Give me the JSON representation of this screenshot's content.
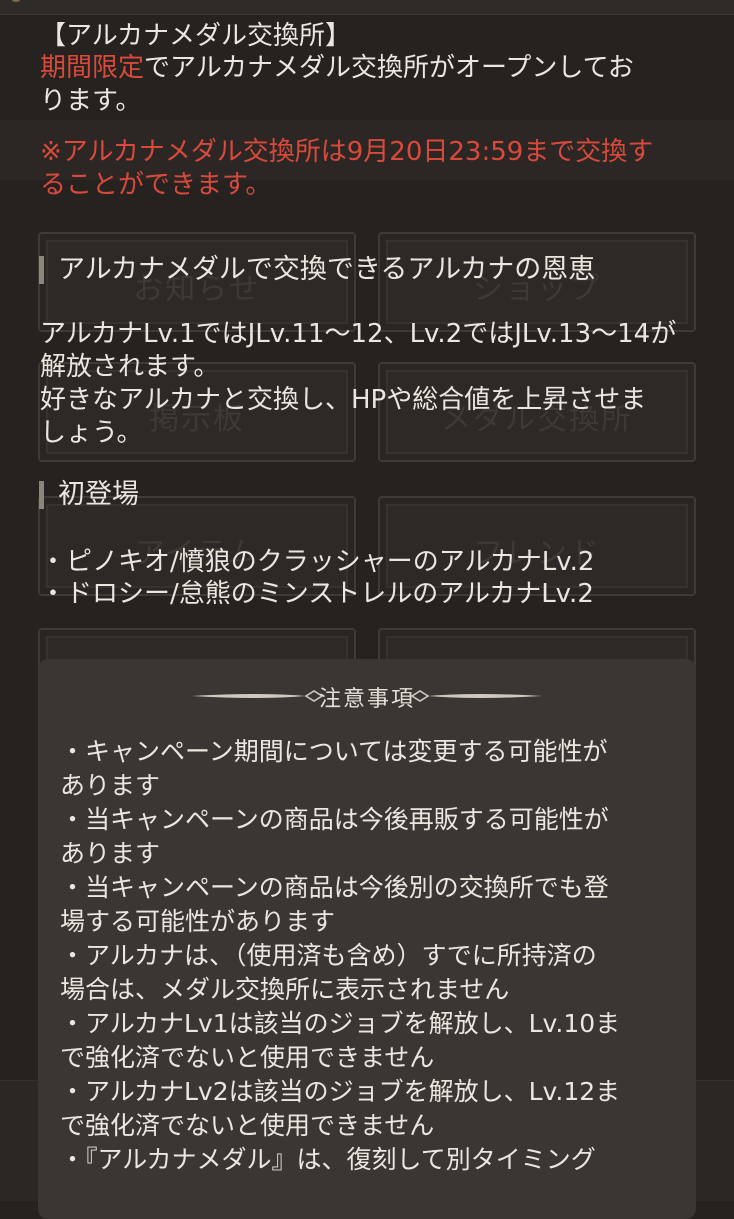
{
  "background": {
    "tiles": [
      {
        "label": "お知らせ"
      },
      {
        "label": "ショップ"
      },
      {
        "label": "掲示板"
      },
      {
        "label": "メダル交換所"
      },
      {
        "label": "アイテム"
      },
      {
        "label": "フレンド"
      }
    ]
  },
  "announcement": {
    "heading": "【アルカナメダル交換所】",
    "intro_highlight": "期間限定",
    "intro_rest_line1": "でアルカナメダル交換所がオープンしてお",
    "intro_line2": "ります。",
    "deadline_line1": "※アルカナメダル交換所は9月20日23:59まで交換す",
    "deadline_line2": "ることができます。",
    "section1_title": "アルカナメダルで交換できるアルカナの恩恵",
    "section1_lines": [
      "アルカナLv.1ではJLv.11～12、Lv.2ではJLv.13～14が",
      "解放されます。",
      "好きなアルカナと交換し、HPや総合値を上昇させま",
      "しょう。"
    ],
    "section2_title": "初登場",
    "section2_items": [
      "・ピノキオ/憤狼のクラッシャーのアルカナLv.2",
      "・ドロシー/怠熊のミンストレルのアルカナLv.2"
    ]
  },
  "notice": {
    "title": "注意事項",
    "lines": [
      "・キャンペーン期間については変更する可能性が",
      "あります",
      "・当キャンペーンの商品は今後再販する可能性が",
      "あります",
      "・当キャンペーンの商品は今後別の交換所でも登",
      "場する可能性があります",
      "・アルカナは、（使用済も含め）すでに所持済の",
      "場合は、メダル交換所に表示されません",
      "・アルカナLv1は該当のジョブを解放し、Lv.10ま",
      "で強化済でないと使用できません",
      "・アルカナLv2は該当のジョブを解放し、Lv.12ま",
      "で強化済でないと使用できません",
      "・『アルカナメダル』は、復刻して別タイミング"
    ]
  },
  "colors": {
    "highlight": "#d94a3c",
    "text": "#ebe6df",
    "panel": "#3a3633",
    "background": "#262220"
  }
}
